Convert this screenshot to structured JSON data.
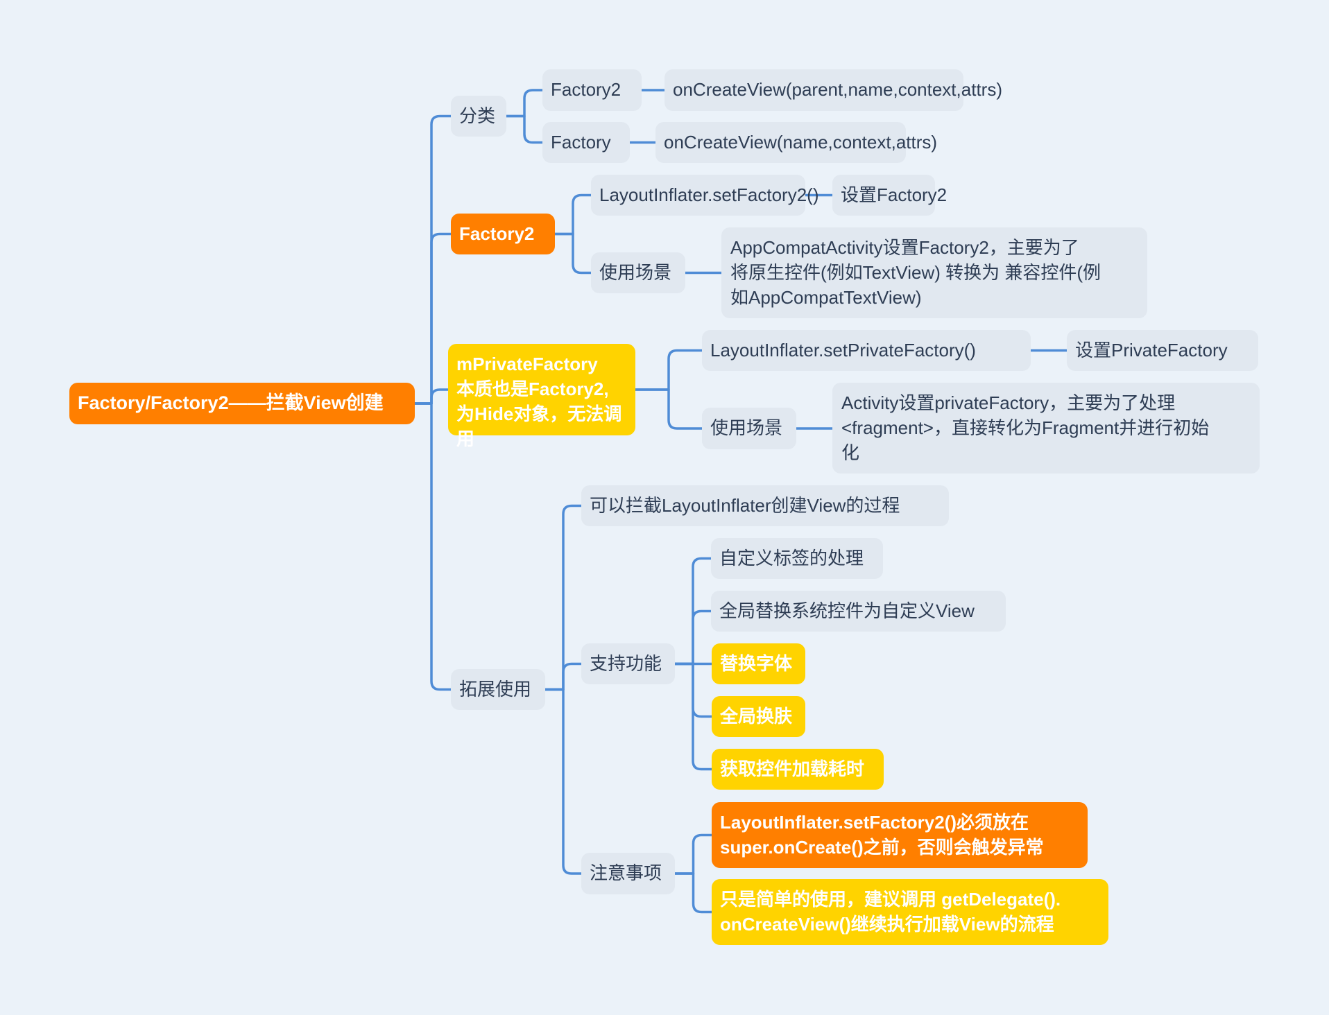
{
  "title": "Factory/Factory2——拦截View创建",
  "colors": {
    "background": "#ebf2f9",
    "line": "#4f8cd6",
    "node_default": "#e1e8f0",
    "text_default": "#2e3d54",
    "highlight_orange": "#ff7f00",
    "highlight_yellow": "#ffd300"
  },
  "root": {
    "label": "Factory/Factory2——拦截View创建"
  },
  "branches": {
    "category": {
      "label": "分类",
      "factory2": {
        "label": "Factory2",
        "method": "onCreateView(parent,name,context,attrs)"
      },
      "factory": {
        "label": "Factory",
        "method": "onCreateView(name,context,attrs)"
      }
    },
    "factory2": {
      "label": "Factory2",
      "setter": {
        "label": "LayoutInflater.setFactory2()",
        "desc": "设置Factory2"
      },
      "usage": {
        "label": "使用场景",
        "desc_lines": [
          "AppCompatActivity设置Factory2，主要为了",
          "将原生控件(例如TextView) 转换为 兼容控件(例",
          "如AppCompatTextView)"
        ]
      }
    },
    "private_factory": {
      "label_lines": [
        "mPrivateFactory",
        "本质也是Factory2,",
        "为Hide对象，无法调用"
      ],
      "setter": {
        "label": "LayoutInflater.setPrivateFactory()",
        "desc": "设置PrivateFactory"
      },
      "usage": {
        "label": "使用场景",
        "desc_lines": [
          "Activity设置privateFactory，主要为了处理",
          "<fragment>，直接转化为Fragment并进行初始",
          "化"
        ]
      }
    },
    "extension": {
      "label": "拓展使用",
      "intercept": {
        "label": "可以拦截LayoutInflater创建View的过程"
      },
      "features": {
        "label": "支持功能",
        "items": [
          "自定义标签的处理",
          "全局替换系统控件为自定义View",
          "替换字体",
          "全局换肤",
          "获取控件加载耗时"
        ]
      },
      "notes": {
        "label": "注意事项",
        "items": [
          {
            "lines": [
              "LayoutInflater.setFactory2()必须放在",
              "super.onCreate()之前，否则会触发异常"
            ]
          },
          {
            "lines": [
              "只是简单的使用，建议调用 getDelegate().",
              "onCreateView()继续执行加载View的流程"
            ]
          }
        ]
      }
    }
  }
}
